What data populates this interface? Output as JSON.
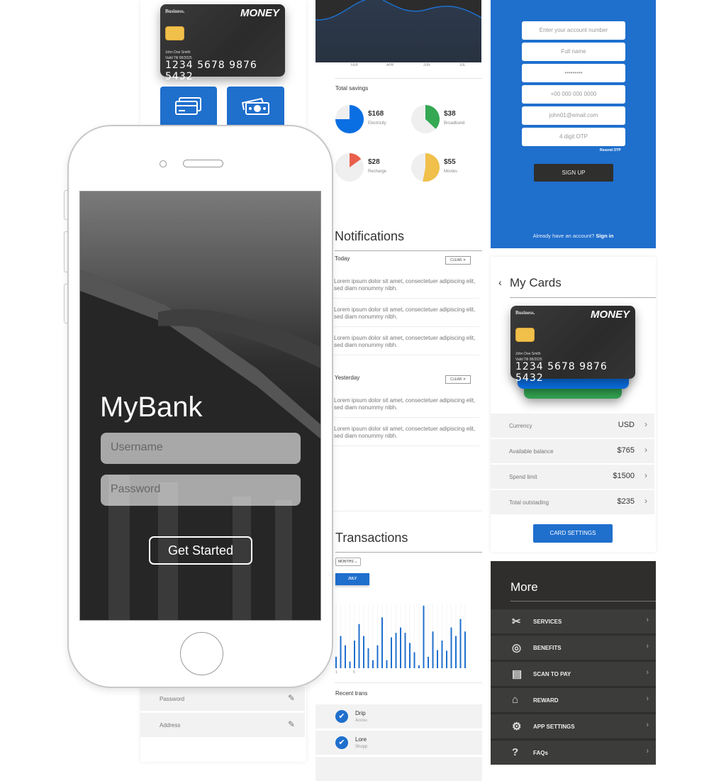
{
  "card": {
    "issuer": "Business.",
    "brand": "MONEY",
    "holder": "John Doe Smith",
    "valid": "Valid Till 08/2025",
    "number": "1234 5678 9876 5432"
  },
  "tiles": [
    {
      "icon": "credit-cards-icon"
    },
    {
      "icon": "cash-icon"
    }
  ],
  "login": {
    "title": "MyBank",
    "username_placeholder": "Username",
    "password_placeholder": "Password",
    "button": "Get Started"
  },
  "profile": {
    "rows": [
      {
        "label": "Password",
        "icon": "pencil-icon"
      },
      {
        "label": "Address",
        "icon": "pencil-icon"
      }
    ]
  },
  "area_chart": {
    "x_labels": [
      "FEB",
      "APR",
      "JUN",
      "JUL"
    ]
  },
  "savings": {
    "title": "Total savings",
    "items": [
      {
        "amount": "$168",
        "label": "Electricity",
        "fraction": 0.75,
        "color": "#0a6fe3"
      },
      {
        "amount": "$38",
        "label": "Broadband",
        "fraction": 0.37,
        "color": "#34a853"
      },
      {
        "amount": "$28",
        "label": "Recharge",
        "fraction": 0.15,
        "color": "#e8604c"
      },
      {
        "amount": "$55",
        "label": "Movies",
        "fraction": 0.53,
        "color": "#f0c04a"
      }
    ]
  },
  "notifications": {
    "title": "Notifications",
    "groups": [
      {
        "label": "Today",
        "clear": "CLEAR",
        "items": [
          "Lorem ipsum dolor sit amet, consectetuer adipiscing elit, sed diam nonummy nibh.",
          "Lorem ipsum dolor sit amet, consectetuer adipiscing elit, sed diam nonummy nibh.",
          "Lorem ipsum dolor sit amet, consectetuer adipiscing elit, sed diam nonummy nibh."
        ]
      },
      {
        "label": "Yesterday",
        "clear": "CLEAR",
        "items": [
          "Lorem ipsum dolor sit amet, consectetuer adipiscing elit, sed diam nonummy nibh.",
          "Lorem ipsum dolor sit amet, consectetuer adipiscing elit, sed diam nonummy nibh."
        ]
      }
    ]
  },
  "transactions": {
    "title": "Transactions",
    "period_select": "MONTHS",
    "month_button": "JULY",
    "recent_title": "Recent trans",
    "recent": [
      {
        "name": "Drip",
        "sub": "Accou"
      },
      {
        "name": "Lore",
        "sub": "Shopp"
      }
    ]
  },
  "chart_data": {
    "type": "bar",
    "x_tick_labels": [
      "1",
      "5"
    ],
    "color": "#1f6fcd",
    "values": [
      43,
      121,
      86,
      25,
      104,
      166,
      121,
      75,
      30,
      86,
      191,
      30,
      116,
      133,
      153,
      133,
      95,
      60,
      11,
      235,
      43,
      138,
      68,
      104,
      66,
      153,
      121,
      185,
      138
    ]
  },
  "signup": {
    "fields": [
      "Enter your account number",
      "Full name",
      "•••••••••",
      "+00 000 000 0000",
      "john01@email.com",
      "4 digit OTP"
    ],
    "resend": "Resend OTP",
    "button": "SIGN UP",
    "footer_text": "Already have an account?",
    "footer_link": "Sign in",
    "bg": "#1f6fcd"
  },
  "my_cards": {
    "title": "My Cards",
    "rows": [
      {
        "label": "Currency",
        "value": "USD"
      },
      {
        "label": "Available balance",
        "value": "$765"
      },
      {
        "label": "Spend limit",
        "value": "$1500"
      },
      {
        "label": "Total outstading",
        "value": "$235"
      }
    ],
    "button": "CARD SETTINGS"
  },
  "more": {
    "title": "More",
    "items": [
      {
        "label": "SERVICES",
        "icon": "tools-icon"
      },
      {
        "label": "BENEFITS",
        "icon": "gamepad-icon"
      },
      {
        "label": "SCAN TO PAY",
        "icon": "scan-icon"
      },
      {
        "label": "REWARD",
        "icon": "gift-icon"
      },
      {
        "label": "APP SETTINGS",
        "icon": "gear-icon"
      },
      {
        "label": "FAQs",
        "icon": "help-icon"
      }
    ]
  }
}
